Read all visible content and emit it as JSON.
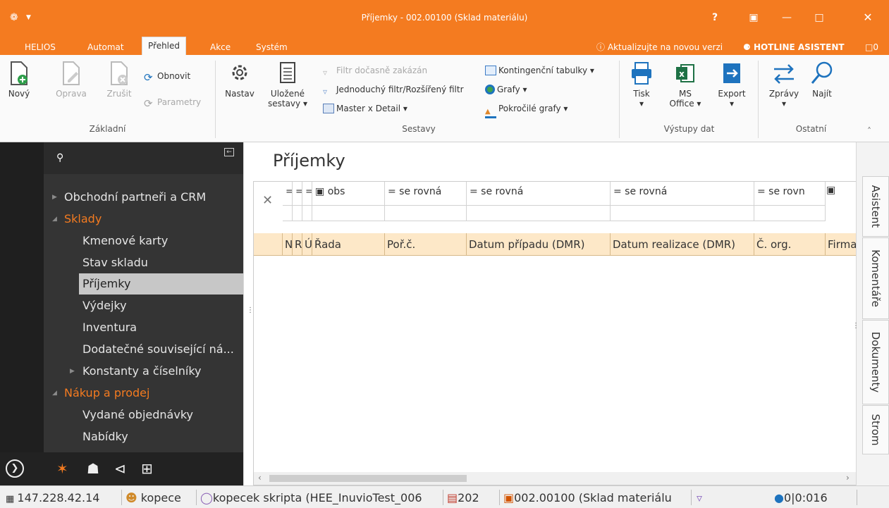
{
  "window": {
    "title": "Příjemky - 002.00100 (Sklad materiálu)",
    "help": "?"
  },
  "menu": {
    "tabs": [
      "HELIOS",
      "Automat",
      "Přehled",
      "Akce",
      "Systém"
    ],
    "update_text": "Aktualizujte na novou verzi",
    "hotline": "HOTLINE ASISTENT",
    "comment_count": "0"
  },
  "ribbon": {
    "novy": "Nový",
    "oprava": "Oprava",
    "zrusit": "Zrušit",
    "obnovit": "Obnovit",
    "parametry": "Parametry",
    "nastav": "Nastav",
    "ulozene_1": "Uložené",
    "ulozene_2": "sestavy",
    "filtr_docasne": "Filtr dočasně zakázán",
    "jednoduchy_filtr": "Jednoduchý filtr/Rozšířený filtr",
    "master_detail": "Master x Detail",
    "kontingencni": "Kontingenční tabulky",
    "grafy": "Grafy",
    "pokrocile_grafy": "Pokročilé grafy",
    "tisk": "Tisk",
    "ms_1": "MS",
    "ms_2": "Office",
    "export": "Export",
    "zpravy": "Zprávy",
    "najit": "Najít",
    "groups": {
      "zakladni": "Základní",
      "sestavy": "Sestavy",
      "vystupy": "Výstupy dat",
      "ostatni": "Ostatní"
    }
  },
  "nav": {
    "items": [
      {
        "label": "Obchodní partneři a CRM"
      },
      {
        "label": "Sklady"
      },
      {
        "label": "Kmenové karty"
      },
      {
        "label": "Stav skladu"
      },
      {
        "label": "Příjemky"
      },
      {
        "label": "Výdejky"
      },
      {
        "label": "Inventura"
      },
      {
        "label": "Dodatečné související ná..."
      },
      {
        "label": "Konstanty a číselníky"
      },
      {
        "label": "Nákup a prodej"
      },
      {
        "label": "Vydané objednávky"
      },
      {
        "label": "Nabídky"
      }
    ]
  },
  "page": {
    "title": "Příjemky"
  },
  "grid": {
    "filter_eq": "=",
    "filter_obs": "obs",
    "filter_rovna": "= se rovná",
    "filter_rovn": "= se rovn",
    "columns": [
      "N",
      "R",
      "Ú",
      "Řada",
      "Poř.č.",
      "Datum případu (DMR)",
      "Datum realizace (DMR)",
      "Č. org.",
      "Firma"
    ]
  },
  "right_tabs": [
    "Asistent",
    "Komentáře",
    "Dokumenty",
    "Strom"
  ],
  "status": {
    "ip": "147.228.42.14",
    "user": "kopece",
    "db": "kopecek skripta (HEE_InuvioTest_006",
    "period": "202",
    "org": "002.00100 (Sklad materiálu",
    "info": "0|0:016"
  },
  "colors": {
    "accent": "#f47b20",
    "header_bg": "#fde8c8"
  }
}
